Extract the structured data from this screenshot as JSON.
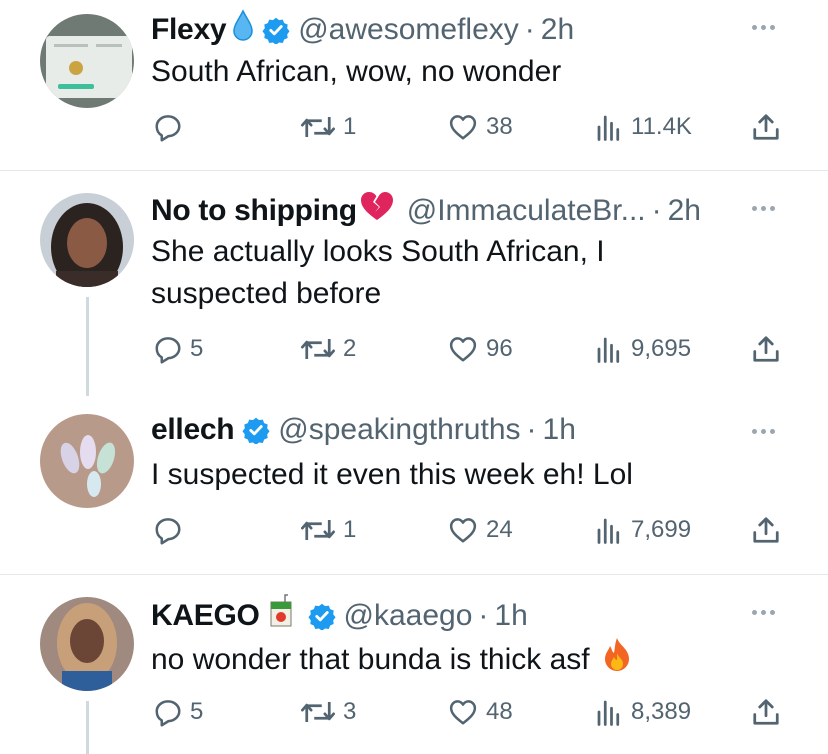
{
  "tweets": [
    {
      "name": "Flexy",
      "name_emoji": "droplet",
      "handle": "@awesomeflexy",
      "separator": "·",
      "time": "2h",
      "text": [
        "South African, wow, no wonder"
      ],
      "actions": {
        "replies": "",
        "retweets": "1",
        "likes": "38",
        "views": "11.4K"
      },
      "verified": true
    },
    {
      "name": "No to shipping",
      "name_emoji": "broken-heart",
      "handle": "@ImmaculateBr...",
      "separator": "·",
      "time": "2h",
      "text": [
        "She actually looks South African, I",
        "suspected before"
      ],
      "actions": {
        "replies": "5",
        "retweets": "2",
        "likes": "96",
        "views": "9,695"
      },
      "verified": false
    },
    {
      "name": "ellech",
      "name_emoji": "",
      "handle": "@speakingthruths",
      "separator": "·",
      "time": "1h",
      "text": [
        "I suspected it even this week eh! Lol"
      ],
      "actions": {
        "replies": "",
        "retweets": "1",
        "likes": "24",
        "views": "7,699"
      },
      "verified": true
    },
    {
      "name": "KAEGO",
      "name_emoji": "juice-box",
      "handle": "@kaaego",
      "separator": "·",
      "time": "1h",
      "text": [
        "no wonder that bunda is thick asf"
      ],
      "text_emoji": "fire",
      "actions": {
        "replies": "5",
        "retweets": "3",
        "likes": "48",
        "views": "8,389"
      },
      "verified": true
    }
  ],
  "colors": {
    "verified": "#1d9bf0",
    "secondary_text": "#536471",
    "primary_text": "#0f1419",
    "broken_heart": "#e0245e"
  }
}
